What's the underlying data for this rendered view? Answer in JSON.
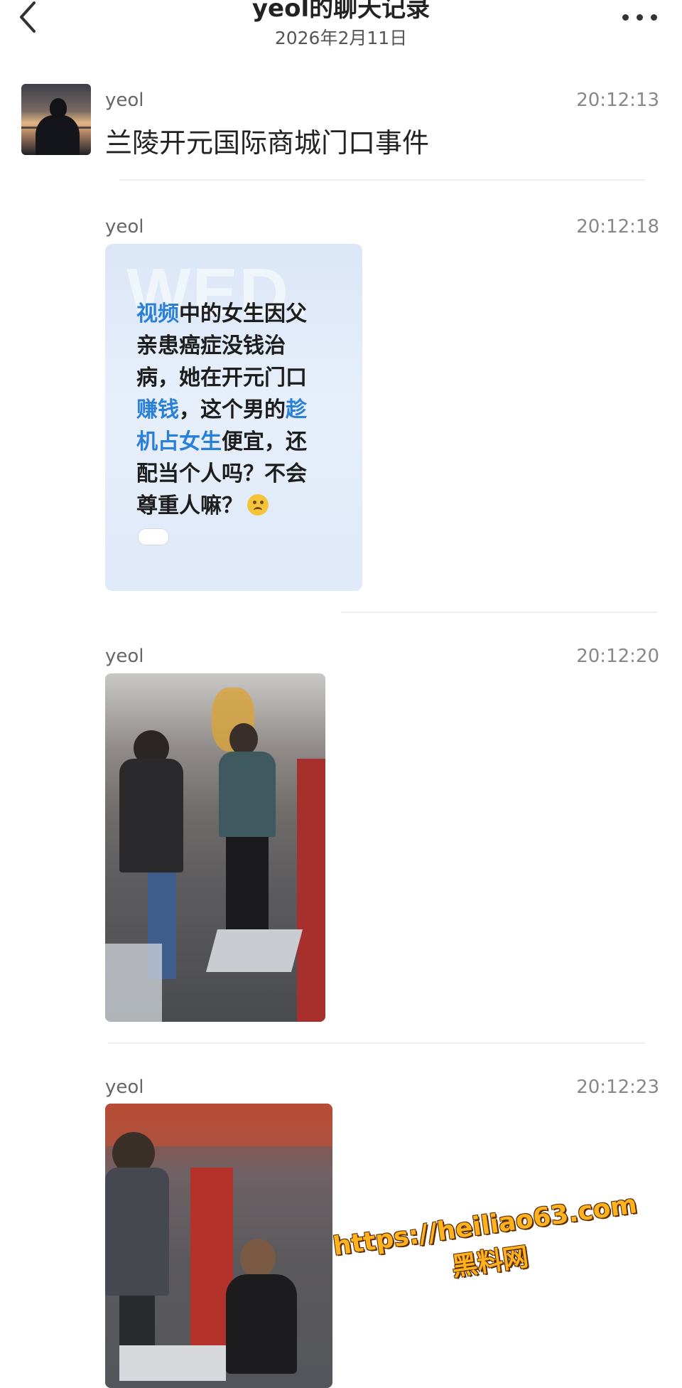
{
  "header": {
    "title": "yeol的聊天记录",
    "date": "2026年2月11日",
    "back_icon": "chevron-left-icon",
    "more_icon": "more-dots-icon"
  },
  "messages": [
    {
      "sender": "yeol",
      "time": "20:12:13",
      "type": "text",
      "text": "兰陵开元国际商城门口事件"
    },
    {
      "sender": "yeol",
      "time": "20:12:18",
      "type": "image-card",
      "card": {
        "watermark": "WED.",
        "lines": [
          [
            {
              "t": "视频",
              "hl": true
            },
            {
              "t": "中的女生因父",
              "hl": false
            }
          ],
          [
            {
              "t": "亲患癌症没钱治",
              "hl": false
            }
          ],
          [
            {
              "t": "病，她在开元门口",
              "hl": false
            }
          ],
          [
            {
              "t": "赚钱",
              "hl": true
            },
            {
              "t": "，这个男的",
              "hl": false
            },
            {
              "t": "趁",
              "hl": true
            }
          ],
          [
            {
              "t": "机占女生",
              "hl": true
            },
            {
              "t": "便宜，还",
              "hl": false
            }
          ],
          [
            {
              "t": "配当个人吗？不会",
              "hl": false
            }
          ],
          [
            {
              "t": "尊重人嘛？",
              "hl": false
            }
          ]
        ],
        "emoji": "crying-face-emoji"
      }
    },
    {
      "sender": "yeol",
      "time": "20:12:20",
      "type": "photo",
      "alt_name": "street-scene-photo-1"
    },
    {
      "sender": "yeol",
      "time": "20:12:23",
      "type": "photo",
      "alt_name": "street-scene-photo-2"
    }
  ],
  "overlay": {
    "url": "https://heiliao63.com",
    "name": "黑料网"
  },
  "colors": {
    "highlight": "#2a7fd6",
    "watermark": "#ffb21e",
    "divider": "#eeeeee"
  }
}
